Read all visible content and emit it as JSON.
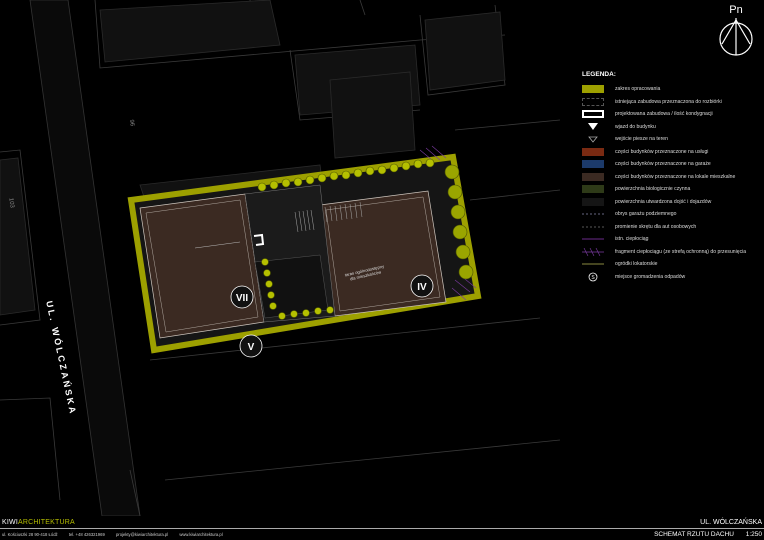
{
  "compass": {
    "label": "Pn"
  },
  "street": {
    "name": "UL. WÓLCZAŃSKA"
  },
  "plot_numbers": {
    "left": "103",
    "top": "96"
  },
  "buildings": {
    "roman_left": "VII",
    "roman_right": "IV",
    "roman_lower": "V"
  },
  "roof_label": {
    "line1": "taras ogólnodostępny",
    "line2": "dla mieszkańców"
  },
  "legend": {
    "title": "LEGENDA:",
    "items": [
      {
        "label": "zakres opracowania",
        "swatch": "fill",
        "color": "#9da000"
      },
      {
        "label": "istniejąca zabudowa przeznaczona do rozbiórki",
        "swatch": "dashbox",
        "color": "#555555"
      },
      {
        "label": "projektowana zabudowa / ilość kondygnacji",
        "swatch": "whitebox",
        "color": "#ffffff"
      },
      {
        "label": "wjazd do budynku",
        "swatch": "tri-fill",
        "color": "#ffffff"
      },
      {
        "label": "wejście piesze na teren",
        "swatch": "tri-outline",
        "color": "#aaaaaa"
      },
      {
        "label": "części budynków przeznaczone na usługi",
        "swatch": "fill",
        "color": "#7a2a12"
      },
      {
        "label": "części budynków przeznaczone na garaże",
        "swatch": "fill",
        "color": "#1c3a6a"
      },
      {
        "label": "części budynków przeznaczone na lokale mieszkalne",
        "swatch": "fill",
        "color": "#3b2a22"
      },
      {
        "label": "powierzchnia biologicznie czynna",
        "swatch": "fill",
        "color": "#2e3a18"
      },
      {
        "label": "powierzchnia utwardzona dojść i dojazdów",
        "swatch": "fill",
        "color": "#151515"
      },
      {
        "label": "obrys garażu podziemnego",
        "swatch": "dashline",
        "color": "#8888aa"
      },
      {
        "label": "promienie skrętu dla aut osobowych",
        "swatch": "dashline",
        "color": "#777777"
      },
      {
        "label": "istn. ciepłociąg",
        "swatch": "line",
        "color": "#6a2a8a"
      },
      {
        "label": "fragment ciepłociągu (ze strefą ochronną) do przesunięcia",
        "swatch": "hatch",
        "color": "#7a3aa0"
      },
      {
        "label": "ogródki lokatorskie",
        "swatch": "line",
        "color": "#8a8a40"
      },
      {
        "label": "miejsce gromadzenia odpadów",
        "swatch": "circle-s",
        "color": "#ffffff"
      }
    ]
  },
  "footer": {
    "brand_kiwi": "KIWI",
    "brand_arch": "ARCHITEKTURA",
    "address": "ul. Kościuszki 28 90-418 Łódź",
    "phone": "tel. +48 426321969",
    "email": "projekty@kiwiarchitektura.pl",
    "web": "www.kiwiarchitektura.pl",
    "street": "UL. WÓLCZAŃSKA",
    "drawing_title": "SCHEMAT RZUTU DACHU",
    "scale": "1:250"
  }
}
